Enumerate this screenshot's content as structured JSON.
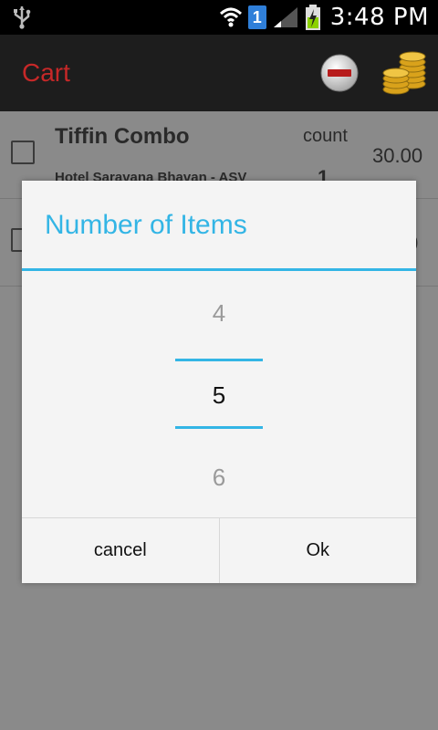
{
  "status_bar": {
    "time": "3:48 PM",
    "notification_badge": "1",
    "icons": [
      "usb-icon",
      "wifi-icon",
      "signal-icon",
      "battery-charging-icon"
    ]
  },
  "action_bar": {
    "title": "Cart",
    "title_color": "#c62828",
    "actions": [
      "remove-icon",
      "coins-icon"
    ]
  },
  "cart": {
    "items": [
      {
        "name": "Tiffin Combo",
        "hotel": "Hotel Saravana Bhavan - ASV",
        "count_label": "count",
        "count": "1",
        "price": "30.00"
      },
      {
        "name": "",
        "hotel": "",
        "count_label": "",
        "count": "",
        "price": "0"
      }
    ]
  },
  "dialog": {
    "title": "Number of Items",
    "accent_color": "#33b5e5",
    "picker": {
      "previous": "4",
      "current": "5",
      "next": "6"
    },
    "cancel_label": "cancel",
    "ok_label": "Ok"
  }
}
